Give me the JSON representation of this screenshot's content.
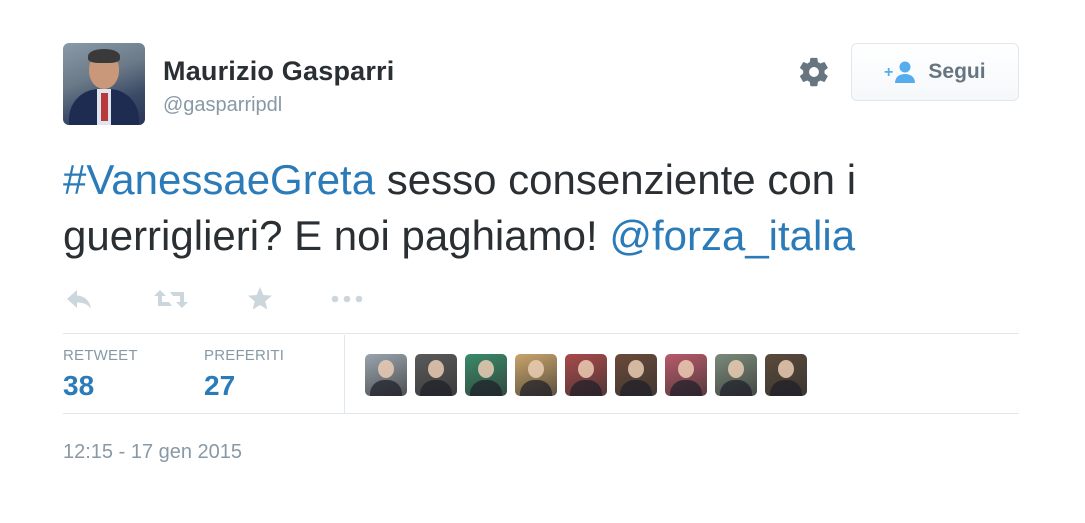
{
  "user": {
    "name": "Maurizio Gasparri",
    "handle": "@gasparripdl"
  },
  "follow_button": {
    "label": "Segui",
    "icon": "follow-user-icon"
  },
  "settings_icon": "gear-icon",
  "tweet": {
    "hashtag": "#VanessaeGreta",
    "text_part1": " sesso consenziente con i guerriglieri? E noi paghiamo! ",
    "mention": "@forza_italia"
  },
  "actions": [
    {
      "name": "reply-icon"
    },
    {
      "name": "retweet-icon"
    },
    {
      "name": "favorite-icon"
    },
    {
      "name": "more-icon"
    }
  ],
  "stats": {
    "retweet_label": "RETWEET",
    "retweet_count": "38",
    "favorites_label": "PREFERITI",
    "favorites_count": "27"
  },
  "favoriter_avatars": [
    {
      "bg": "#9aa4ae"
    },
    {
      "bg": "#5a5a5a"
    },
    {
      "bg": "#3a8a6a"
    },
    {
      "bg": "#c9a46a"
    },
    {
      "bg": "#a84a4a"
    },
    {
      "bg": "#6a4a3a"
    },
    {
      "bg": "#b85a6a"
    },
    {
      "bg": "#7a8a7a"
    },
    {
      "bg": "#5a4a3a"
    }
  ],
  "timestamp": "12:15 - 17 gen 2015",
  "colors": {
    "link": "#2b7bb9",
    "muted": "#8899a6",
    "text": "#292f33",
    "border": "#e1e8ed"
  }
}
